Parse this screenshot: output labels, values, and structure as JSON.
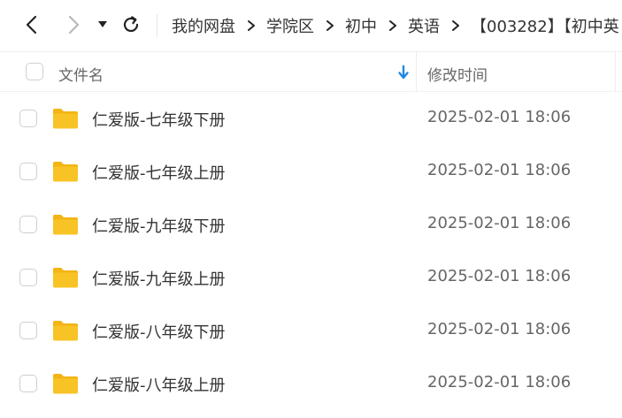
{
  "toolbar": {
    "back_icon": "chevron-left-icon",
    "forward_icon": "chevron-right-icon",
    "history_dropdown_icon": "caret-down-icon",
    "refresh_icon": "refresh-icon"
  },
  "breadcrumb": {
    "items": [
      "我的网盘",
      "学院区",
      "初中",
      "英语",
      "【003282】【初中英"
    ],
    "separator_icon": "chevron-right-icon"
  },
  "table": {
    "name_header": "文件名",
    "time_header": "修改时间",
    "sort_icon": "arrow-down-icon",
    "sort_color": "#1e88e5"
  },
  "files": [
    {
      "name": "仁爱版-七年级下册",
      "modified": "2025-02-01 18:06",
      "icon": "folder-icon"
    },
    {
      "name": "仁爱版-七年级上册",
      "modified": "2025-02-01 18:06",
      "icon": "folder-icon"
    },
    {
      "name": "仁爱版-九年级下册",
      "modified": "2025-02-01 18:06",
      "icon": "folder-icon"
    },
    {
      "name": "仁爱版-九年级上册",
      "modified": "2025-02-01 18:06",
      "icon": "folder-icon"
    },
    {
      "name": "仁爱版-八年级下册",
      "modified": "2025-02-01 18:06",
      "icon": "folder-icon"
    },
    {
      "name": "仁爱版-八年级上册",
      "modified": "2025-02-01 18:06",
      "icon": "folder-icon"
    }
  ],
  "colors": {
    "folder": "#f8c325",
    "folder_dark": "#f3b414",
    "checkbox_border": "#cfcfcf"
  }
}
